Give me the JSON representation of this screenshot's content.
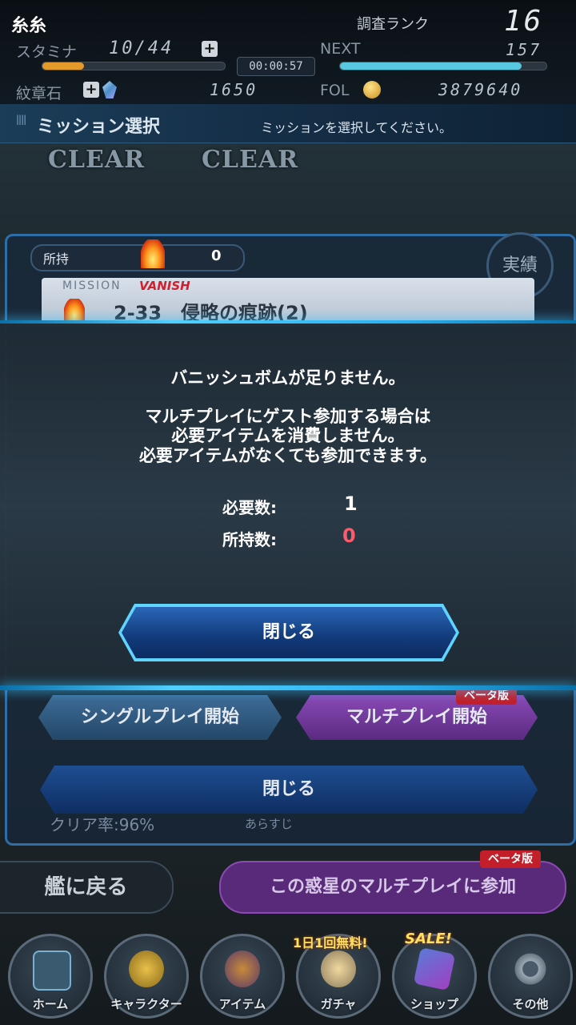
{
  "header": {
    "player_name": "糸糸",
    "rank_label": "調査ランク",
    "rank_value": "16",
    "stamina_label": "スタミナ",
    "stamina_value": "10/44",
    "stamina_fraction": 0.23,
    "plus": "+",
    "next_label": "NEXT",
    "next_value": "157",
    "next_fraction": 0.88,
    "timer": "00:00:57",
    "emblem_label": "紋章石",
    "emblem_value": "1650",
    "fol_label": "FOL",
    "fol_value": "3879640"
  },
  "mission_bar": {
    "title": "ミッション選択",
    "hint": "ミッションを選択してください。"
  },
  "background": {
    "clear_1": "CLEAR",
    "clear_2": "CLEAR",
    "owned_label": "所持",
    "owned_value": "0",
    "mission_tag": "MISSION",
    "vanish_tag": "VANISH",
    "mission_title": "2-33　侵略の痕跡(2)",
    "jisseki": "実績",
    "single_play": "シングルプレイ開始",
    "multi_play": "マルチプレイ開始",
    "beta_1": "ベータ版",
    "close_back": "閉じる",
    "clear_rate": "クリア率:96%",
    "synopsis": "あらすじ"
  },
  "dialog": {
    "line1": "バニッシュボムが足りません。",
    "line2": "マルチプレイにゲスト参加する場合は",
    "line3": "必要アイテムを消費しません。",
    "line4": "必要アイテムがなくても参加できます。",
    "required_label": "必要数:",
    "required_value": "1",
    "owned_label": "所持数:",
    "owned_value": "0",
    "close_button": "閉じる"
  },
  "bottom": {
    "back_ship": "艦に戻る",
    "join_multi": "この惑星のマルチプレイに参加",
    "beta_2": "ベータ版"
  },
  "nav": {
    "home": "ホーム",
    "character": "キャラクター",
    "item": "アイテム",
    "gacha": "ガチャ",
    "gacha_badge": "1日1回無料!",
    "shop": "ショップ",
    "shop_badge": "SALE!",
    "other": "その他"
  },
  "colors": {
    "accent_blue": "#4fd0ff",
    "warning_red": "#ff5a6a",
    "stamina_orange": "#e39a2a",
    "next_cyan": "#58c8e0"
  }
}
